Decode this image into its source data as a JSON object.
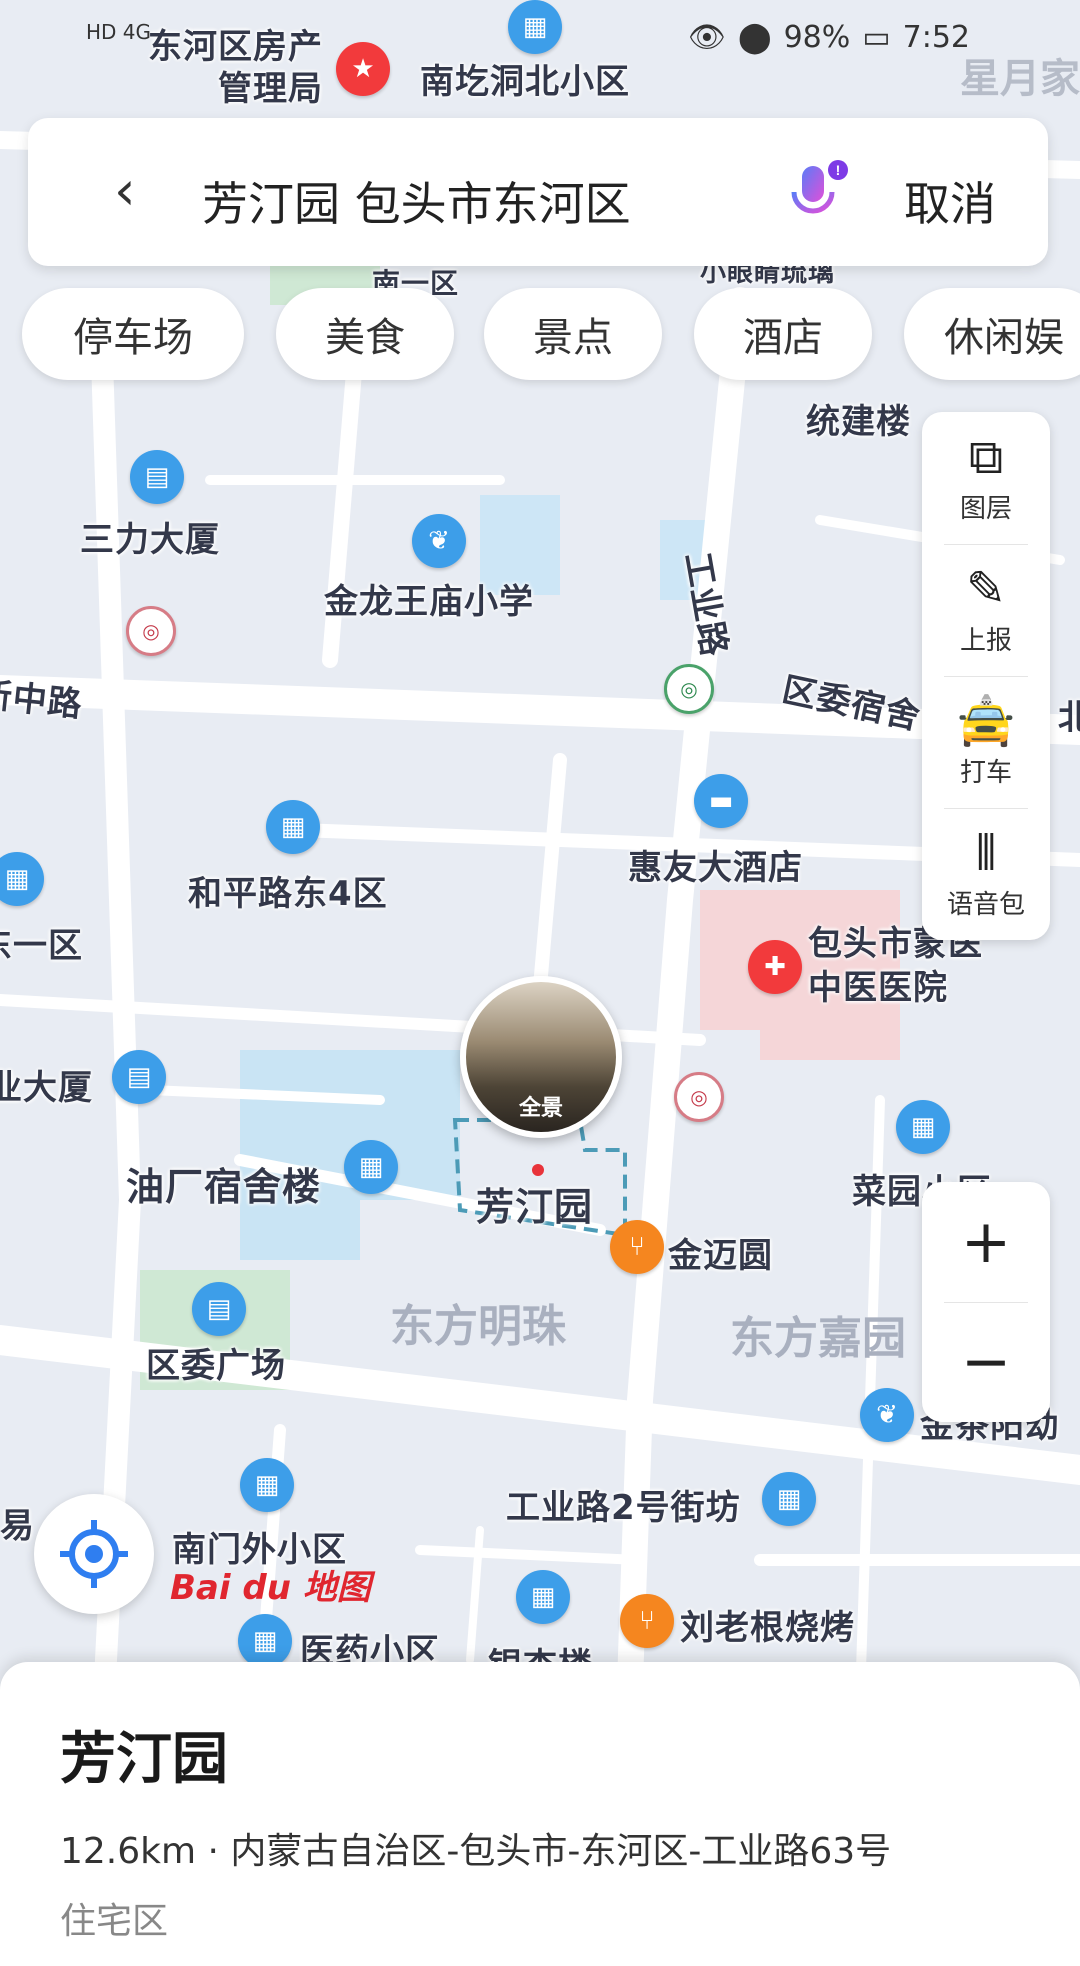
{
  "status_bar": {
    "left_text": "HD 4G",
    "battery": "98%",
    "time": "7:52",
    "watermark": "星月家"
  },
  "search": {
    "back_icon": "chevron-left-icon",
    "query": "芳汀园 包头市东河区",
    "mic_icon": "microphone-icon",
    "cancel_label": "取消"
  },
  "chips": [
    "停车场",
    "美食",
    "景点",
    "酒店",
    "休闲娱"
  ],
  "toolbar": {
    "layers_label": "图层",
    "report_label": "上报",
    "taxi_label": "打车",
    "voice_label": "语音包"
  },
  "zoom": {
    "in_label": "+",
    "out_label": "−"
  },
  "panorama_label": "全景",
  "map_labels": {
    "donghe_realestate": "东河区房产\n管理局",
    "nanqitong": "南圪洞北小区",
    "nanyiqu": "南一区",
    "xiaoyan": "小眼睛琉璃",
    "tongjianlou": "统建楼",
    "sanli": "三力大厦",
    "jinlong": "金龙王庙小学",
    "gongyelu": "工业路",
    "xinzhonglu": "新中路",
    "quwei_dorm": "区委宿舍",
    "bei": "北",
    "huiyou": "惠友大酒店",
    "heping": "和平路东4区",
    "dongyiqu": "东一区",
    "baotou_hospital": "包头市蒙医\n中医医院",
    "yedasha": "业大厦",
    "youchang": "油厂宿舍楼",
    "fangtingyuan": "芳汀园",
    "caiyuan": "菜园小区",
    "jinmai": "金迈圆",
    "dongfang_mingzhu": "东方明珠",
    "dongfang_jiayuan": "东方嘉园",
    "quwei_square": "区委广场",
    "jinxiang": "金茶阳幼",
    "gongye2": "工业路2号街坊",
    "nanmenwai": "南门外小区",
    "yi": "易",
    "yiyao": "医药小区",
    "yinxing": "银杏楼",
    "liulaogen": "刘老根烧烤"
  },
  "logo_text": "Bai du 地图",
  "place": {
    "title": "芳汀园",
    "address": "12.6km · 内蒙古自治区-包头市-东河区-工业路63号",
    "category": "住宅区"
  }
}
